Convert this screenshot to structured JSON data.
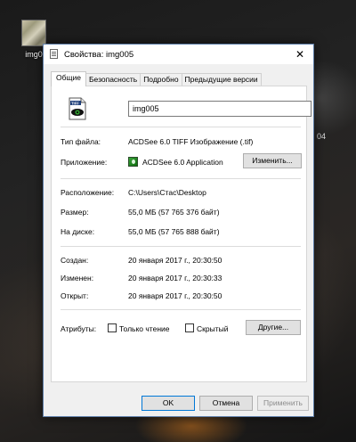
{
  "desktop": {
    "icon_label": "img0",
    "right_fragment": "04"
  },
  "window": {
    "title": "Свойства: img005",
    "close_glyph": "✕",
    "tabs": [
      {
        "label": "Общие",
        "active": true
      },
      {
        "label": "Безопасность",
        "active": false
      },
      {
        "label": "Подробно",
        "active": false
      },
      {
        "label": "Предыдущие версии",
        "active": false
      }
    ],
    "general": {
      "filename": "img005",
      "file_type_label": "Тип файла:",
      "file_type_value": "ACDSee 6.0 TIFF Изображение (.tif)",
      "app_label": "Приложение:",
      "app_value": "ACDSee 6.0 Application",
      "change_button": "Изменить...",
      "location_label": "Расположение:",
      "location_value": "C:\\Users\\Стас\\Desktop",
      "size_label": "Размер:",
      "size_value": "55,0 МБ (57 765 376 байт)",
      "disk_label": "На диске:",
      "disk_value": "55,0 МБ (57 765 888 байт)",
      "created_label": "Создан:",
      "created_value": "20 января 2017 г., 20:30:50",
      "modified_label": "Изменен:",
      "modified_value": "20 января 2017 г., 20:30:33",
      "opened_label": "Открыт:",
      "opened_value": "20 января 2017 г., 20:30:50",
      "attributes_label": "Атрибуты:",
      "readonly_label": "Только чтение",
      "readonly_checked": false,
      "hidden_label": "Скрытый",
      "hidden_checked": false,
      "other_button": "Другие..."
    },
    "buttons": {
      "ok": "OK",
      "cancel": "Отмена",
      "apply": "Применить"
    },
    "file_icon_text": "TIFF"
  }
}
